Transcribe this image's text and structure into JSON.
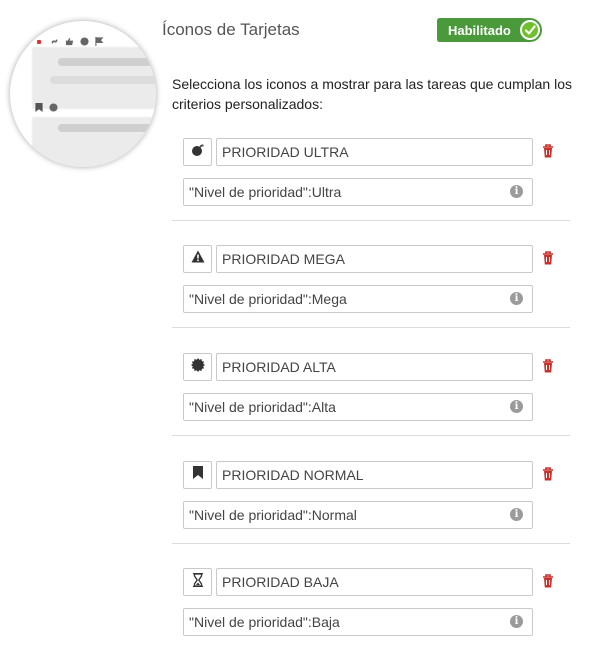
{
  "section": {
    "title": "Íconos de Tarjetas",
    "toggle_label": "Habilitado",
    "toggle_enabled": true,
    "description": "Selecciona los iconos a mostrar para las tareas que cumplan los criterios personalizados:"
  },
  "colors": {
    "toggle_bg": "#4a9a3b",
    "toggle_knob": "#6fbf2f",
    "trash": "#c9302c",
    "info": "#9b9b9b"
  },
  "rules": [
    {
      "icon": "bomb-icon",
      "name": "PRIORIDAD ULTRA",
      "criteria": "\"Nivel de prioridad\":Ultra"
    },
    {
      "icon": "warning-icon",
      "name": "PRIORIDAD MEGA",
      "criteria": "\"Nivel de prioridad\":Mega"
    },
    {
      "icon": "certificate-icon",
      "name": "PRIORIDAD ALTA",
      "criteria": "\"Nivel de prioridad\":Alta"
    },
    {
      "icon": "bookmark-icon",
      "name": "PRIORIDAD NORMAL",
      "criteria": "\"Nivel de prioridad\":Normal"
    },
    {
      "icon": "hourglass-icon",
      "name": "PRIORIDAD BAJA",
      "criteria": "\"Nivel de prioridad\":Baja"
    }
  ]
}
